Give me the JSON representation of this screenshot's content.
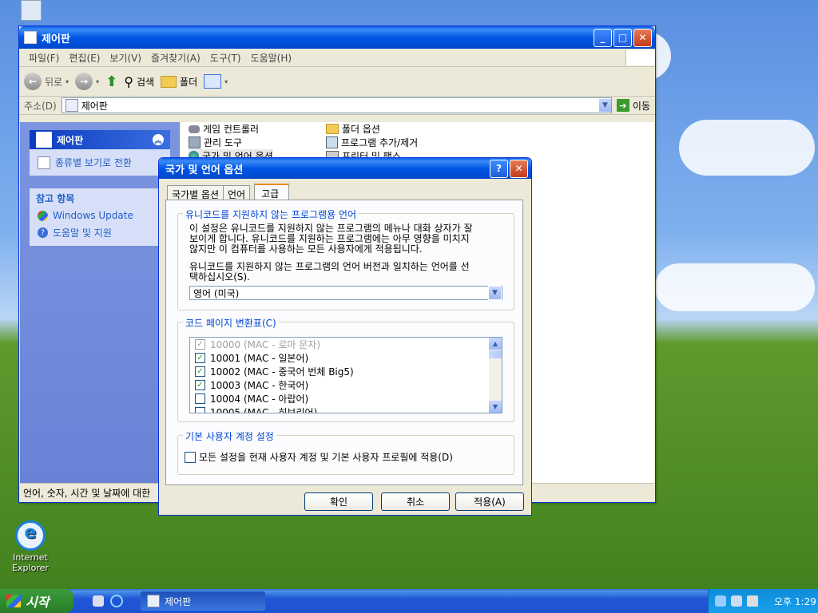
{
  "desktop": {
    "ie_label_line1": "Internet",
    "ie_label_line2": "Explorer"
  },
  "explorer": {
    "title": "제어판",
    "menu": [
      "파일(F)",
      "편집(E)",
      "보기(V)",
      "즐겨찾기(A)",
      "도구(T)",
      "도움말(H)"
    ],
    "toolbar": {
      "back": "뒤로",
      "search": "검색",
      "folders": "폴더"
    },
    "address": {
      "label": "주소(D)",
      "value": "제어판",
      "go": "이동"
    },
    "side": {
      "panel_title": "제어판",
      "switch_view": "종류별 보기로 전환",
      "see_also_title": "참고 항목",
      "see_also": [
        "Windows Update",
        "도움말 및 지원"
      ]
    },
    "items": [
      {
        "label": "게임 컨트롤러",
        "icon": "game-controller-icon"
      },
      {
        "label": "폴더 옵션",
        "icon": "folder-options-icon"
      },
      {
        "label": "관리 도구",
        "icon": "admin-tools-icon"
      },
      {
        "label": "프로그램 추가/제거",
        "icon": "add-remove-programs-icon"
      },
      {
        "label": "국가 및 언어 옵션",
        "icon": "globe-icon"
      },
      {
        "label": "프린터 및 팩스",
        "icon": "printer-icon"
      }
    ],
    "status": "언어, 숫자, 시간 및 날짜에 대한"
  },
  "dialog": {
    "title": "국가 및 언어 옵션",
    "tabs": [
      "국가별 옵션",
      "언어",
      "고급"
    ],
    "active_tab": "고급",
    "unicode_group": {
      "label": "유니코드를 지원하지 않는 프로그램용 언어",
      "desc1_line1": "이 설정은 유니코드를 지원하지 않는 프로그램의 메뉴나 대화 상자가 잘",
      "desc1_line2": "보이게 합니다. 유니코드를 지원하는 프로그램에는 아무 영향을 미치지",
      "desc1_line3": "않지만 이 컴퓨터를 사용하는 모든 사용자에게 적용됩니다.",
      "desc2_line1": "유니코드를 지원하지 않는 프로그램의 언어 버전과 일치하는 언어를 선",
      "desc2_line2": "택하십시오(S).",
      "selected": "영어 (미국)"
    },
    "codepage_group": {
      "label": "코드 페이지 변환표(C)",
      "rows": [
        {
          "text": "10000 (MAC - 로마 문자)",
          "checked": true,
          "disabled": true
        },
        {
          "text": "10001 (MAC - 일본어)",
          "checked": true,
          "disabled": false
        },
        {
          "text": "10002 (MAC - 중국어 번체 Big5)",
          "checked": true,
          "disabled": false
        },
        {
          "text": "10003 (MAC - 한국어)",
          "checked": true,
          "disabled": false
        },
        {
          "text": "10004 (MAC - 아랍어)",
          "checked": false,
          "disabled": false
        },
        {
          "text": "10005 (MAC - 히브리어)",
          "checked": false,
          "disabled": false
        }
      ]
    },
    "default_group": {
      "label": "기본 사용자 계정 설정",
      "checkbox": "모든 설정을 현재 사용자 계정 및 기본 사용자 프로필에 적용(D)",
      "checked": false
    },
    "buttons": {
      "ok": "확인",
      "cancel": "취소",
      "apply": "적용(A)"
    }
  },
  "taskbar": {
    "start": "시작",
    "task": "제어판",
    "clock": "오후 1:29"
  }
}
